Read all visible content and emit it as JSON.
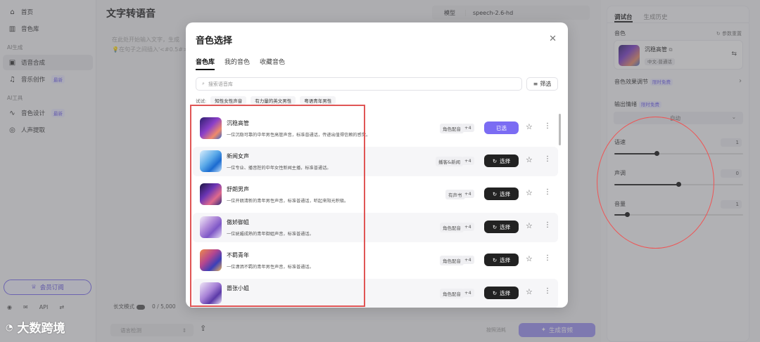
{
  "sidebar": {
    "items_top": [
      {
        "label": "首页",
        "icon": "home-icon"
      },
      {
        "label": "音色库",
        "icon": "library-icon"
      }
    ],
    "section_ai_gen": "AI生成",
    "items_gen": [
      {
        "label": "语音合成",
        "icon": "voice-synth-icon",
        "active": true
      },
      {
        "label": "音乐创作",
        "icon": "music-icon",
        "badge": "最新"
      }
    ],
    "section_ai_tools": "AI工具",
    "items_tools": [
      {
        "label": "音色设计",
        "icon": "voice-design-icon",
        "badge": "最新"
      },
      {
        "label": "人声提取",
        "icon": "extract-icon"
      }
    ],
    "subscribe_label": "会员订阅",
    "api_label": "API"
  },
  "main": {
    "title": "文字转语音",
    "model_label": "模型",
    "model_value": "speech-2.6-hd",
    "placeholder_line1": "在此处开始输入文字，生成",
    "placeholder_line2": "在句子之间插入'<#0.5#>",
    "long_text_label": "长文模式",
    "char_count": "0 / 5,000",
    "lang_detect": "语言检测",
    "charge_label": "按照消耗",
    "generate_label": "生成音频"
  },
  "right_panel": {
    "tab_debug": "调试台",
    "tab_history": "生成历史",
    "voice_label": "音色",
    "reset_label": "参数重置",
    "voice_name": "沉稳高管",
    "voice_tag": "中文-普通话",
    "effect_label": "音色效果调节",
    "effect_badge": "限时免费",
    "emotion_label": "输出情绪",
    "emotion_badge": "限时免费",
    "emotion_value": "自动",
    "speed_label": "语速",
    "speed_value": "1",
    "pitch_label": "声调",
    "pitch_value": "0",
    "volume_label": "音量",
    "volume_value": "1"
  },
  "modal": {
    "title": "音色选择",
    "tabs": [
      "音色库",
      "我的音色",
      "收藏音色"
    ],
    "search_placeholder": "搜索语音库",
    "filter_label": "筛选",
    "try_label": "试试:",
    "try_chips": [
      "知性女性声音",
      "有力量的英文男性",
      "粤语青年男性"
    ],
    "voices": [
      {
        "name": "沉稳高管",
        "desc": "一位沉稳可靠的中年男性高管声音，标准普通话，传递出值得信赖的感觉。",
        "tag": "角色配音",
        "count": "+4",
        "button": "已选",
        "selected": true,
        "thumb": "linear-gradient(135deg,#2d1f6e 0%,#8b3fc9 45%,#f08b6a 75%,#3763c9 100%)"
      },
      {
        "name": "新闻女声",
        "desc": "一位专业、播音腔的中年女性新闻主播，标准普通话。",
        "tag": "播客&新闻",
        "count": "+4",
        "button": "选择",
        "selected": false,
        "thumb": "linear-gradient(135deg,#d9eefc 0%,#5aa9e8 45%,#1b6bd0 70%,#bfe0fb 100%)"
      },
      {
        "name": "舒朗男声",
        "desc": "一位开朗清新的青年男性声音，标准普通话，听起来阳光积极。",
        "tag": "有声书",
        "count": "+4",
        "button": "选择",
        "selected": false,
        "thumb": "linear-gradient(135deg,#1c1540 0%,#6b35b5 40%,#e06a8c 70%,#2f2a7a 100%)"
      },
      {
        "name": "傲娇御姐",
        "desc": "一位妩媚成熟的青年御姐声音，标准普通话。",
        "tag": "角色配音",
        "count": "+4",
        "button": "选择",
        "selected": false,
        "thumb": "linear-gradient(135deg,#f2ecf8 0%,#b08ad9 40%,#7d57c6 65%,#e9def5 100%)"
      },
      {
        "name": "不羁青年",
        "desc": "一位潇洒不羁的青年男性声音，标准普通话。",
        "tag": "角色配音",
        "count": "+4",
        "button": "选择",
        "selected": false,
        "thumb": "linear-gradient(135deg,#ee8a4a 0%,#b6478f 40%,#3b3fb8 70%,#f0b35a 100%)"
      },
      {
        "name": "嚣张小姐",
        "desc": "",
        "tag": "角色配音",
        "count": "+4",
        "button": "选择",
        "selected": false,
        "thumb": "linear-gradient(135deg,#efe6f6 0%,#a781d6 45%,#5b3aa8 70%,#e9dff5 100%)"
      }
    ]
  },
  "watermark": "大数跨境"
}
